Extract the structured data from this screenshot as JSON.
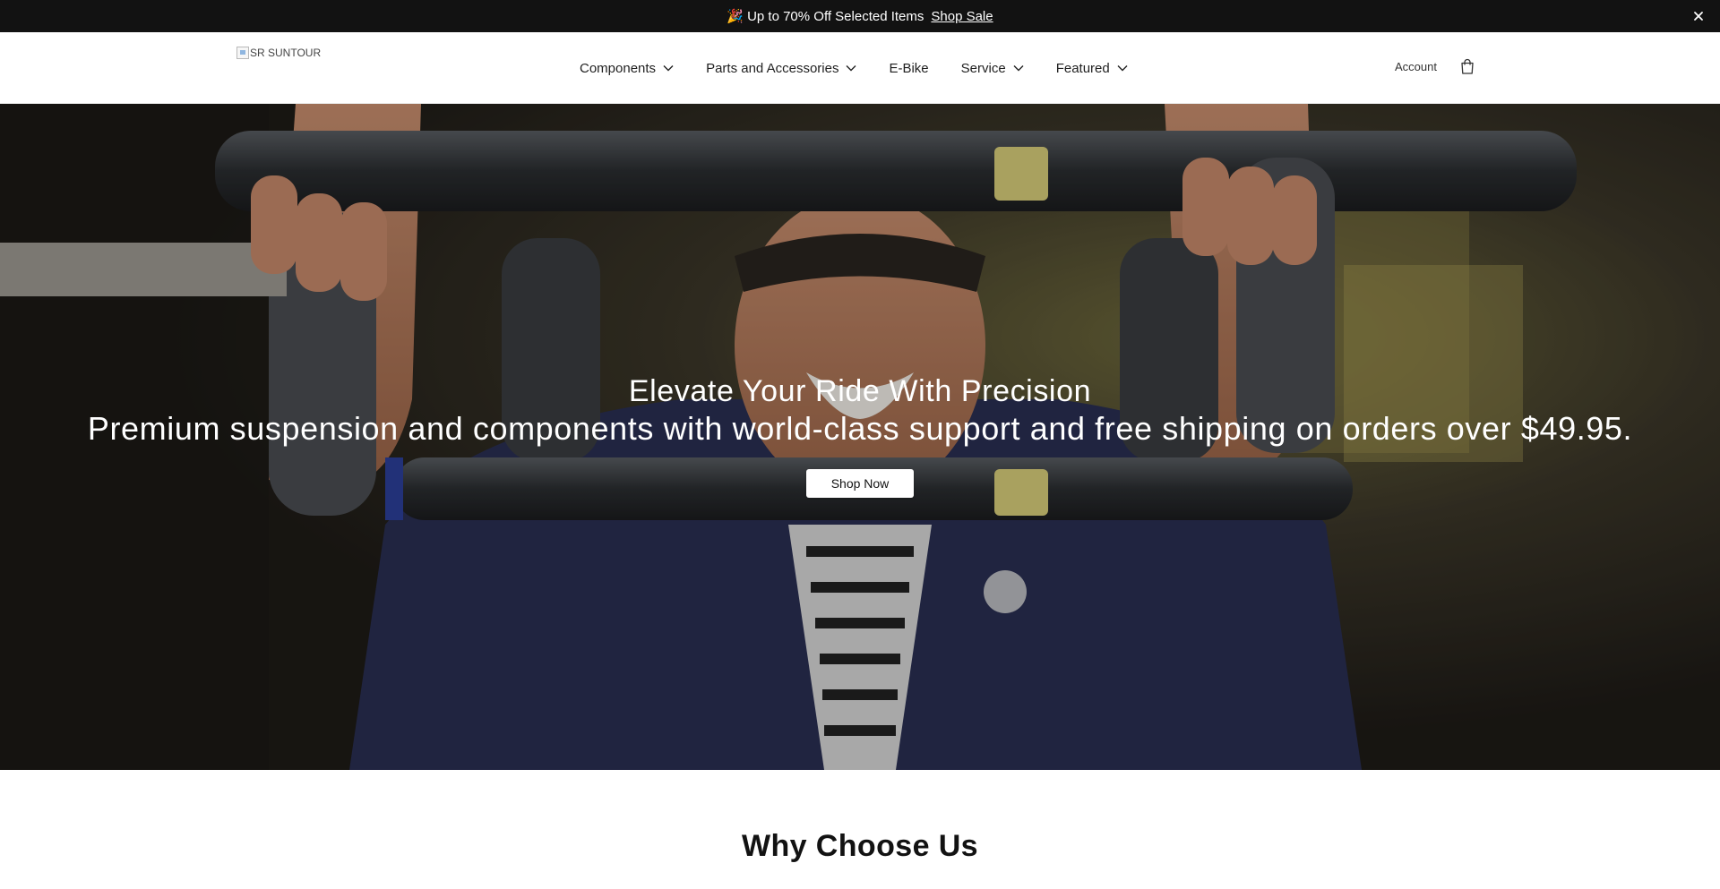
{
  "announcement": {
    "emoji": "🎉",
    "text": "Up to 70% Off Selected Items",
    "link_label": "Shop Sale",
    "close_icon": "close-icon"
  },
  "header": {
    "logo_alt": "SR SUNTOUR",
    "nav": [
      {
        "label": "Components",
        "has_dropdown": true
      },
      {
        "label": "Parts and Accessories",
        "has_dropdown": true
      },
      {
        "label": "E-Bike",
        "has_dropdown": false
      },
      {
        "label": "Service",
        "has_dropdown": true
      },
      {
        "label": "Featured",
        "has_dropdown": true
      }
    ],
    "account_label": "Account",
    "cart_icon": "shopping-bag-icon"
  },
  "hero": {
    "title": "Elevate Your Ride With Precision",
    "subtitle": "Premium suspension and components with world-class support and free shipping on orders over $49.95.",
    "cta_label": "Shop Now"
  },
  "why": {
    "heading": "Why Choose Us"
  },
  "colors": {
    "announcement_bg": "#121212",
    "text": "#121212",
    "hero_shirt": "#2a2f52",
    "fork_decal": "#d9cf7a"
  }
}
